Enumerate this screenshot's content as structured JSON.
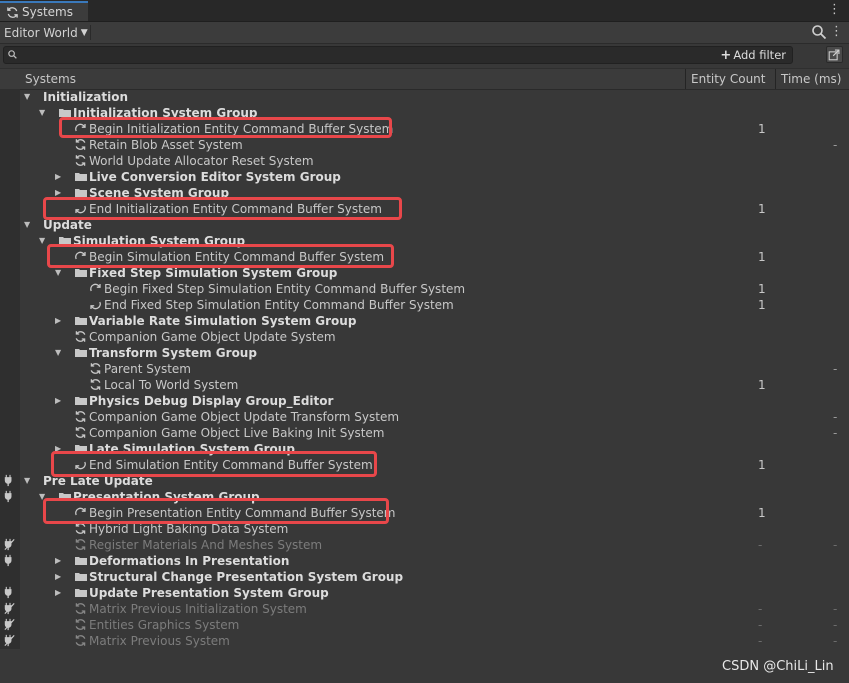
{
  "window": {
    "tab_title": "Systems",
    "tab_icon": "refresh-cycle-icon",
    "menu_icon": "kebab-menu-icon"
  },
  "toolbar": {
    "world_selector": "Editor World",
    "search_icon": "search-icon"
  },
  "filter": {
    "value": "",
    "placeholder": "",
    "add_filter": "Add filter"
  },
  "columns": {
    "systems": "Systems",
    "entity_count": "Entity Count",
    "time": "Time (ms)"
  },
  "colors": {
    "background": "#383838",
    "highlight": "#e8474a",
    "tab_accent": "#3a79bb",
    "dim_text": "#7c7c7c"
  },
  "rows": [
    {
      "label": "Initialization",
      "kind": "root",
      "depth": 0,
      "expanded": true,
      "count": "",
      "time": ""
    },
    {
      "label": "Initialization System Group",
      "kind": "group",
      "depth": 1,
      "expanded": true,
      "count": "",
      "time": ""
    },
    {
      "label": "Begin Initialization Entity Command Buffer System",
      "kind": "begin",
      "depth": 2,
      "count": "1",
      "time": "",
      "highlight": true
    },
    {
      "label": "Retain Blob Asset System",
      "kind": "system",
      "depth": 2,
      "count": "",
      "time": "-"
    },
    {
      "label": "World Update Allocator Reset System",
      "kind": "system",
      "depth": 2,
      "count": "",
      "time": ""
    },
    {
      "label": "Live Conversion Editor System Group",
      "kind": "group",
      "depth": 2,
      "expanded": false,
      "count": "",
      "time": ""
    },
    {
      "label": "Scene System Group",
      "kind": "group",
      "depth": 2,
      "expanded": false,
      "count": "",
      "time": ""
    },
    {
      "label": "End Initialization Entity Command Buffer System",
      "kind": "end",
      "depth": 2,
      "count": "1",
      "time": "",
      "highlight": true
    },
    {
      "label": "Update",
      "kind": "root",
      "depth": 0,
      "expanded": true,
      "count": "",
      "time": ""
    },
    {
      "label": "Simulation System Group",
      "kind": "group",
      "depth": 1,
      "expanded": true,
      "count": "",
      "time": ""
    },
    {
      "label": "Begin Simulation Entity Command Buffer System",
      "kind": "begin",
      "depth": 2,
      "count": "1",
      "time": "",
      "highlight": true
    },
    {
      "label": "Fixed Step Simulation System Group",
      "kind": "group",
      "depth": 2,
      "expanded": true,
      "count": "",
      "time": ""
    },
    {
      "label": "Begin Fixed Step Simulation Entity Command Buffer System",
      "kind": "begin",
      "depth": 3,
      "count": "1",
      "time": ""
    },
    {
      "label": "End Fixed Step Simulation Entity Command Buffer System",
      "kind": "end",
      "depth": 3,
      "count": "1",
      "time": ""
    },
    {
      "label": "Variable Rate Simulation System Group",
      "kind": "group",
      "depth": 2,
      "expanded": false,
      "count": "",
      "time": ""
    },
    {
      "label": "Companion Game Object Update System",
      "kind": "system",
      "depth": 2,
      "count": "",
      "time": ""
    },
    {
      "label": "Transform System Group",
      "kind": "group",
      "depth": 2,
      "expanded": true,
      "count": "",
      "time": ""
    },
    {
      "label": "Parent System",
      "kind": "system",
      "depth": 3,
      "count": "",
      "time": "-"
    },
    {
      "label": "Local To World System",
      "kind": "system",
      "depth": 3,
      "count": "1",
      "time": ""
    },
    {
      "label": "Physics Debug Display Group_Editor",
      "kind": "group",
      "depth": 2,
      "expanded": false,
      "count": "",
      "time": ""
    },
    {
      "label": "Companion Game Object Update Transform System",
      "kind": "system",
      "depth": 2,
      "count": "",
      "time": "-"
    },
    {
      "label": "Companion Game Object Live Baking Init System",
      "kind": "system",
      "depth": 2,
      "count": "",
      "time": "-"
    },
    {
      "label": "Late Simulation System Group",
      "kind": "group",
      "depth": 2,
      "expanded": false,
      "count": "",
      "time": ""
    },
    {
      "label": "End Simulation Entity Command Buffer System",
      "kind": "end",
      "depth": 2,
      "count": "1",
      "time": "",
      "highlight": true
    },
    {
      "label": "Pre Late Update",
      "kind": "root",
      "depth": 0,
      "expanded": true,
      "count": "",
      "time": "",
      "left_icon": "plug-connected-icon"
    },
    {
      "label": "Presentation System Group",
      "kind": "group",
      "depth": 1,
      "expanded": true,
      "count": "",
      "time": "",
      "left_icon": "plug-connected-icon"
    },
    {
      "label": "Begin Presentation Entity Command Buffer System",
      "kind": "begin",
      "depth": 2,
      "count": "1",
      "time": "",
      "highlight": true
    },
    {
      "label": "Hybrid Light Baking Data System",
      "kind": "system",
      "depth": 2,
      "count": "",
      "time": ""
    },
    {
      "label": "Register Materials And Meshes System",
      "kind": "system",
      "depth": 2,
      "count": "-",
      "time": "-",
      "dim": true,
      "left_icon": "plug-disconnected-icon"
    },
    {
      "label": "Deformations In Presentation",
      "kind": "group",
      "depth": 2,
      "expanded": false,
      "count": "",
      "time": "",
      "left_icon": "plug-connected-icon"
    },
    {
      "label": "Structural Change Presentation System Group",
      "kind": "group",
      "depth": 2,
      "expanded": false,
      "count": "",
      "time": ""
    },
    {
      "label": "Update Presentation System Group",
      "kind": "group",
      "depth": 2,
      "expanded": false,
      "count": "",
      "time": "",
      "left_icon": "plug-connected-icon"
    },
    {
      "label": "Matrix Previous Initialization System",
      "kind": "system",
      "depth": 2,
      "count": "-",
      "time": "-",
      "dim": true,
      "left_icon": "plug-disconnected-icon"
    },
    {
      "label": "Entities Graphics System",
      "kind": "system",
      "depth": 2,
      "count": "-",
      "time": "-",
      "dim": true,
      "left_icon": "plug-disconnected-icon"
    },
    {
      "label": "Matrix Previous System",
      "kind": "system",
      "depth": 2,
      "count": "-",
      "time": "-",
      "dim": true,
      "left_icon": "plug-disconnected-icon"
    }
  ],
  "watermark": "CSDN @ChiLi_Lin"
}
